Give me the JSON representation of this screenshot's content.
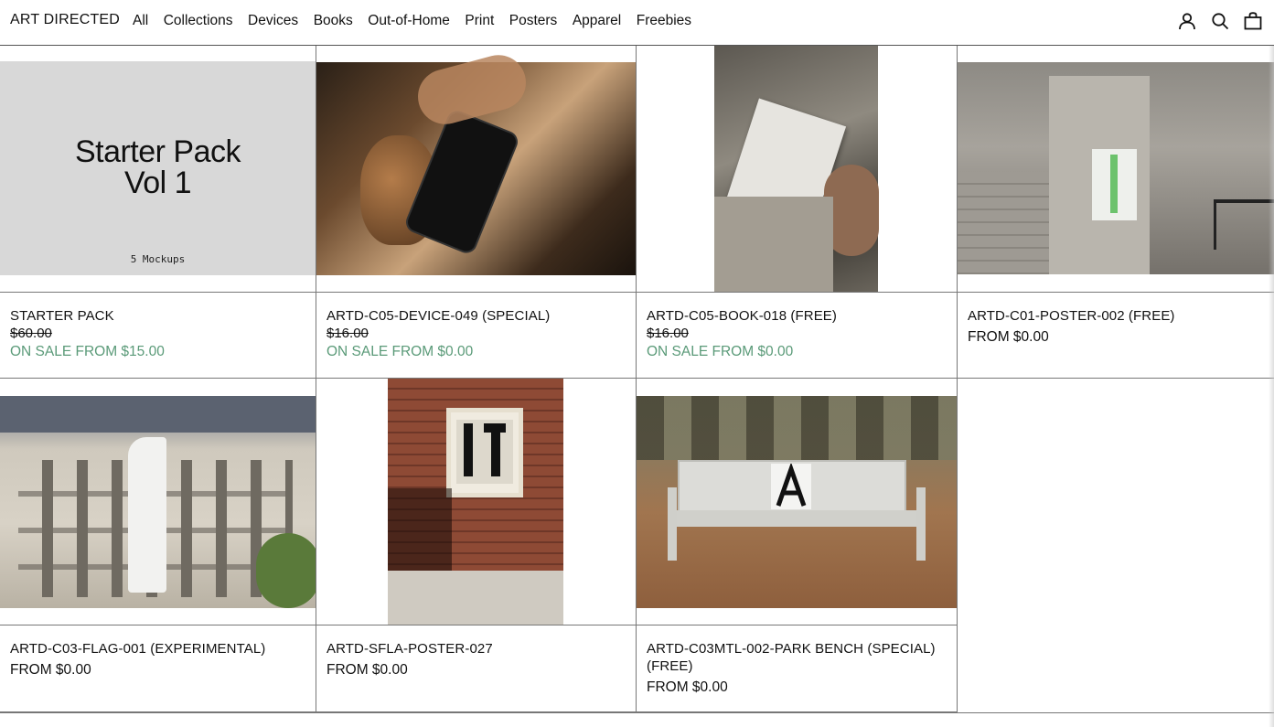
{
  "header": {
    "logo": "ART DIRECTED",
    "nav": [
      "All",
      "Collections",
      "Devices",
      "Books",
      "Out-of-Home",
      "Print",
      "Posters",
      "Apparel",
      "Freebies"
    ],
    "icons": [
      "account-icon",
      "search-icon",
      "bag-icon"
    ]
  },
  "products": [
    {
      "title": "STARTER PACK",
      "compare_price": "$60.00",
      "sale_text": "ON SALE FROM $15.00",
      "image": {
        "headline_line1": "Starter Pack",
        "headline_line2": "Vol 1",
        "subline": "5 Mockups"
      }
    },
    {
      "title": "ARTD-C05-DEVICE-049 (SPECIAL)",
      "compare_price": "$16.00",
      "sale_text": "ON SALE FROM $0.00"
    },
    {
      "title": "ARTD-C05-BOOK-018 (FREE)",
      "compare_price": "$16.00",
      "sale_text": "ON SALE FROM $0.00"
    },
    {
      "title": "ARTD-C01-POSTER-002 (FREE)",
      "price_text": "FROM $0.00"
    },
    {
      "title": "ARTD-C03-FLAG-001 (EXPERIMENTAL)",
      "price_text": "FROM $0.00"
    },
    {
      "title": "ARTD-SFLA-POSTER-027",
      "price_text": "FROM $0.00"
    },
    {
      "title": "ARTD-C03MTL-002-PARK BENCH (SPECIAL) (FREE)",
      "price_text": "FROM $0.00"
    }
  ],
  "colors": {
    "sale_green": "#5a9a78",
    "border": "#777777"
  }
}
